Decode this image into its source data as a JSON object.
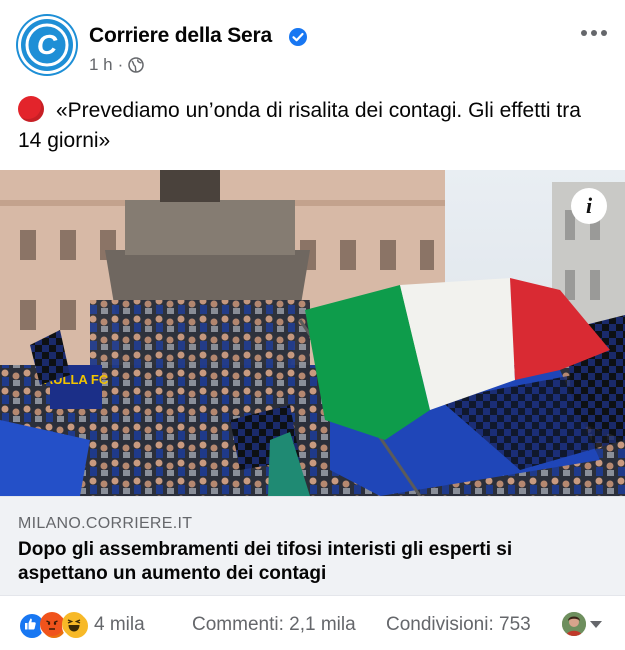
{
  "post": {
    "page_name": "Corriere della Sera",
    "time": "1 h",
    "separator": "·",
    "text": "«Prevediamo un’onda di risalita dei contagi. Gli effetti tra 14 giorni»"
  },
  "link": {
    "domain": "MILANO.CORRIERE.IT",
    "title": "Dopo gli assembramenti dei tifosi interisti gli esperti si aspettano un aumento dei contagi"
  },
  "footer": {
    "reaction_count": "4 mila",
    "comments": "Commenti: 2,1 mila",
    "shares": "Condivisioni: 753"
  },
  "photo": {
    "info_label": "i",
    "banner_text": "AULLA FC"
  },
  "icons": {
    "avatar": "corriere-logo-icon",
    "verified": "verified-badge-icon",
    "privacy": "globe-icon",
    "more": "more-options-icon",
    "emoji": "red-circle-icon",
    "reactions": [
      "like-icon",
      "angry-icon",
      "haha-icon"
    ]
  },
  "colors": {
    "brand_blue": "#1e8fd6",
    "fb_blue": "#1877f2",
    "secondary_text": "#65676b",
    "link_bg": "#f0f2f5"
  }
}
